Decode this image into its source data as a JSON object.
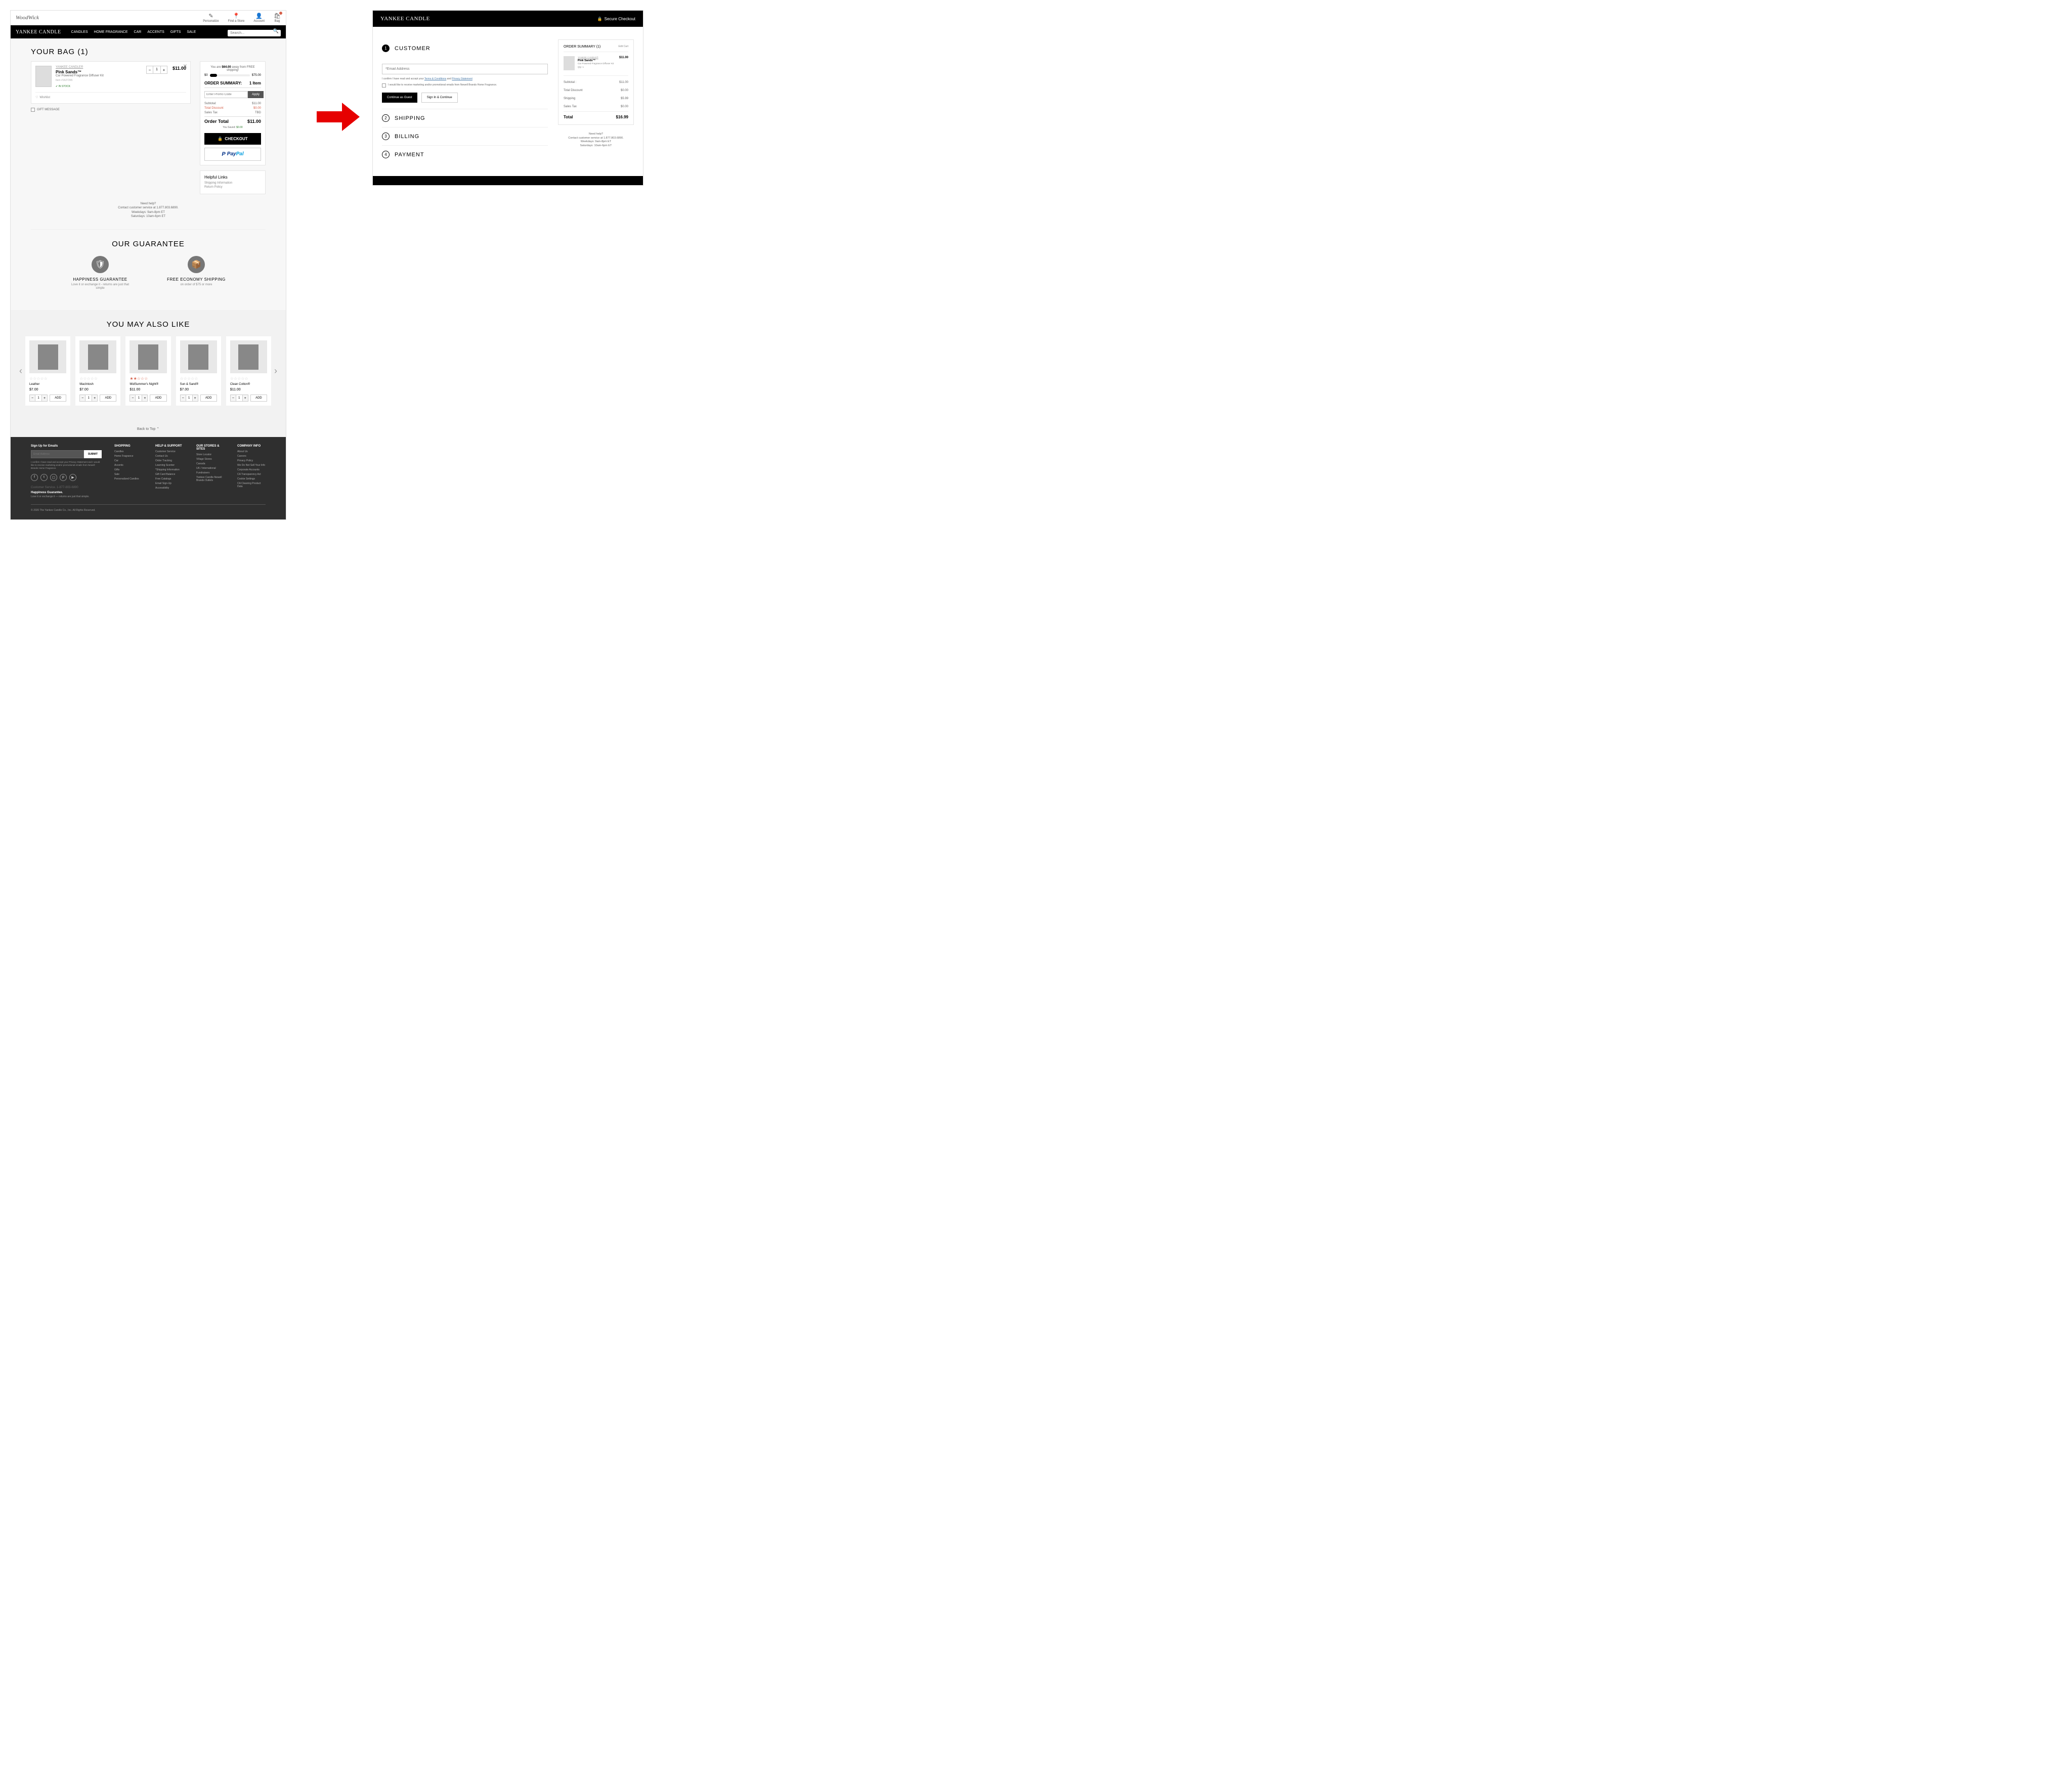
{
  "brand": "YANKEE CANDLE",
  "woodwick": "WoodWick",
  "utility": {
    "personalize": "Personalize",
    "findstore": "Find a Store",
    "account": "Account",
    "bag": "Bag"
  },
  "nav": [
    "CANDLES",
    "HOME FRAGRANCE",
    "CAR",
    "ACCENTS",
    "GIFTS",
    "SALE"
  ],
  "search_placeholder": "Search...",
  "bag_title": "YOUR BAG (1)",
  "item": {
    "brand": "YANKEE CANDLE®",
    "name": "Pink Sands™",
    "desc": "Car Powered Fragrance Diffuser Kit",
    "sku": "Item #1627265",
    "stock": "IN STOCK",
    "qty": "1",
    "price": "$11.00",
    "wishlist": "Wishlist"
  },
  "gift": "GIFT MESSAGE",
  "progress": {
    "text_pre": "You are ",
    "amount": "$64.00",
    "text_post": " away from FREE shipping!",
    "start": "$0",
    "end": "$75.00"
  },
  "summary": {
    "title": "ORDER SUMMARY:",
    "items": "1 Item",
    "promo_placeholder": "Enter Promo Code",
    "apply": "Apply",
    "subtotal_label": "Subtotal:",
    "subtotal": "$11.00",
    "discount_label": "Total Discount",
    "discount": "$0.00",
    "tax_label": "Sales Tax",
    "tax": "TBD",
    "total_label": "Order Total",
    "total": "$11.00",
    "saved_label": "You Saved: ",
    "saved": "$0.00",
    "checkout": "CHECKOUT"
  },
  "helpful": {
    "title": "Helpful Links",
    "links": [
      "Shipping Information",
      "Return Policy"
    ]
  },
  "need_help": {
    "title": "Need help?",
    "line1": "Contact customer service at 1.877.803.6890.",
    "line2": "Weekdays: 9am-8pm ET",
    "line3": "Saturdays: 10am-6pm ET"
  },
  "guarantee": {
    "title": "OUR GUARANTEE",
    "items": [
      {
        "title": "HAPPINESS GUARANTEE",
        "desc": "Love it or exchange it - returns are just that simple"
      },
      {
        "title": "FREE ECONOMY SHIPPING",
        "desc": "on order of $75 or more"
      }
    ]
  },
  "ymal": {
    "title": "YOU MAY ALSO LIKE",
    "products": [
      {
        "name": "Leather",
        "price": "$7.00",
        "rating": 0
      },
      {
        "name": "MacIntosh",
        "price": "$7.00",
        "rating": 0
      },
      {
        "name": "MidSummer's Night®",
        "price": "$11.00",
        "rating": 2
      },
      {
        "name": "Sun & Sand®",
        "price": "$7.00",
        "rating": 0
      },
      {
        "name": "Clean Cotton®",
        "price": "$11.00",
        "rating": 0
      }
    ],
    "add": "ADD"
  },
  "back_top": "Back to Top",
  "footer": {
    "signup_title": "Sign Up for Emails",
    "email_placeholder": "Email Address",
    "submit": "SUBMIT",
    "legal": "I confirm I have read and accept your Privacy Statement and I would like to receive marketing and/or promotional emails from Newell Brands Home Fragrance.",
    "cols": [
      {
        "head": "SHOPPING",
        "links": [
          "Candles",
          "Home Fragrance",
          "Car",
          "Accents",
          "Gifts",
          "Sale",
          "Personalized Candles"
        ]
      },
      {
        "head": "HELP & SUPPORT",
        "links": [
          "Customer Service",
          "Contact Us",
          "Order Tracking",
          "Learning Scenter",
          "*Shipping Information",
          "Gift Card Balance",
          "Free Catalogs",
          "Email Sign-Up",
          "Accessibility"
        ]
      },
      {
        "head": "OUR STORES & SITES",
        "links": [
          "Store Locator",
          "Village Stores",
          "Canada",
          "UK / International",
          "Fundraisers",
          "Yankee Candle-Newell Brands Outlets"
        ]
      },
      {
        "head": "COMPANY INFO",
        "links": [
          "About Us",
          "Careers",
          "Privacy Policy",
          "We Do Not Sell Your Info",
          "Corporate Accounts",
          "CA Transparency Act",
          "Cookie Settings",
          "CA Cleaning Product Data"
        ]
      }
    ],
    "cs": "Customer Service. 1-877-803-6890",
    "hg": "Happiness Guarantee.",
    "hg_desc": "Love it or exchange it — returns are just that simple.",
    "copyright": "© 2020 The Yankee Candle Co., Inc. All Rights Reserved."
  },
  "checkout": {
    "secure": "Secure Checkout",
    "steps": {
      "s1": "CUSTOMER",
      "s2": "SHIPPING",
      "s3": "BILLING",
      "s4": "PAYMENT"
    },
    "email_placeholder": "*Email Address",
    "legal_pre": "I confirm I have read and accept your ",
    "terms": "Terms & Conditions",
    "and": " and ",
    "privacy": "Privacy Statement",
    "opt_in": "I would like to receive marketing and/or promotional emails from Newell Brands Home Fragrance.",
    "guest_btn": "Continue as Guest",
    "signin_btn": "Sign In & Continue",
    "summary_title": "ORDER SUMMARY (1)",
    "edit": "Edit Cart",
    "qty": "Qty: 1",
    "subtotal_label": "Subtotal :",
    "subtotal": "$11.00",
    "discount_label": "Total Discount",
    "discount": "$0.00",
    "shipping_label": "Shipping",
    "shipping": "$5.99",
    "tax_label": "Sales Tax",
    "tax": "$0.00",
    "total_label": "Total",
    "total": "$16.99"
  }
}
